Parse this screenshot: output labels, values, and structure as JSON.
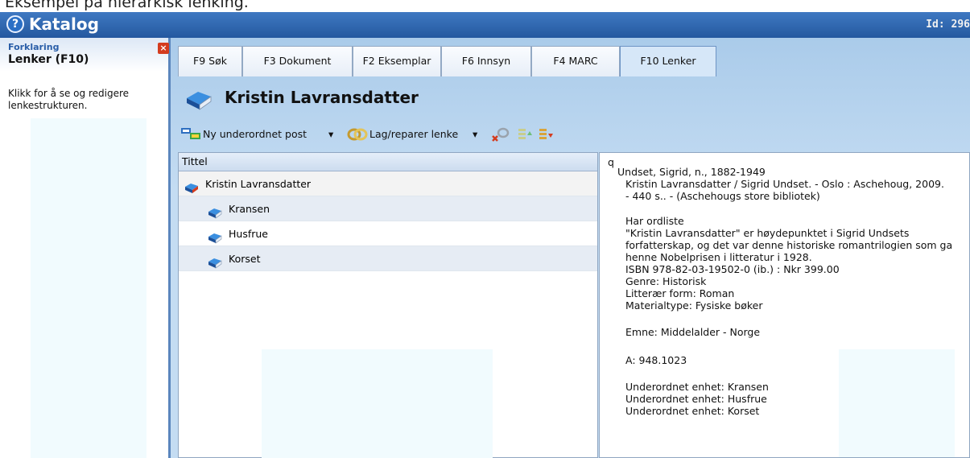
{
  "caption": "Eksempel på hierarkisk lenking.",
  "app": {
    "title": "Katalog",
    "help_glyph": "?",
    "record_id": "Id: 296"
  },
  "side_panel": {
    "category": "Forklaring",
    "title": "Lenker (F10)",
    "close_glyph": "×",
    "description": "Klikk for å se og redigere lenkestrukturen."
  },
  "tabs": [
    {
      "label": "F9 Søk",
      "active": false
    },
    {
      "label": "F3 Dokument",
      "active": false
    },
    {
      "label": "F2 Eksemplar",
      "active": false
    },
    {
      "label": "F6 Innsyn",
      "active": false
    },
    {
      "label": "F4 MARC",
      "active": false
    },
    {
      "label": "F10 Lenker",
      "active": true
    }
  ],
  "document": {
    "title": "Kristin Lavransdatter"
  },
  "toolbar": {
    "new_child_label": "Ny underordnet post",
    "link_label": "Lag/reparer lenke",
    "dropdown_glyph": "▾"
  },
  "tree": {
    "column_header": "Tittel",
    "items": [
      {
        "label": "Kristin Lavransdatter",
        "level": 0
      },
      {
        "label": "Kransen",
        "level": 1
      },
      {
        "label": "Husfrue",
        "level": 1
      },
      {
        "label": "Korset",
        "level": 1
      }
    ]
  },
  "details": {
    "lines": [
      "q",
      "Undset, Sigrid, n., 1882-1949",
      "Kristin Lavransdatter / Sigrid Undset. - Oslo : Aschehoug, 2009.",
      "- 440 s.. - (Aschehougs store bibliotek)",
      "",
      "Har ordliste",
      "\"Kristin Lavransdatter\" er høydepunktet i Sigrid Undsets",
      "forfatterskap, og det var denne historiske romantrilogien som ga",
      "henne Nobelprisen i litteratur i 1928.",
      "ISBN 978-82-03-19502-0 (ib.) : Nkr 399.00",
      "Genre: Historisk",
      "Litterær form: Roman",
      "Materialtype: Fysiske bøker",
      "",
      "Emne: Middelalder - Norge",
      "",
      "A: 948.1023",
      "",
      "Underordnet enhet: Kransen",
      "Underordnet enhet: Husfrue",
      "Underordnet enhet: Korset"
    ]
  },
  "colors": {
    "titlebar": "#24589f",
    "panel_background": "#c4dcf2",
    "book_icon": "#1f67b8",
    "red_accent": "#d43c1f"
  }
}
